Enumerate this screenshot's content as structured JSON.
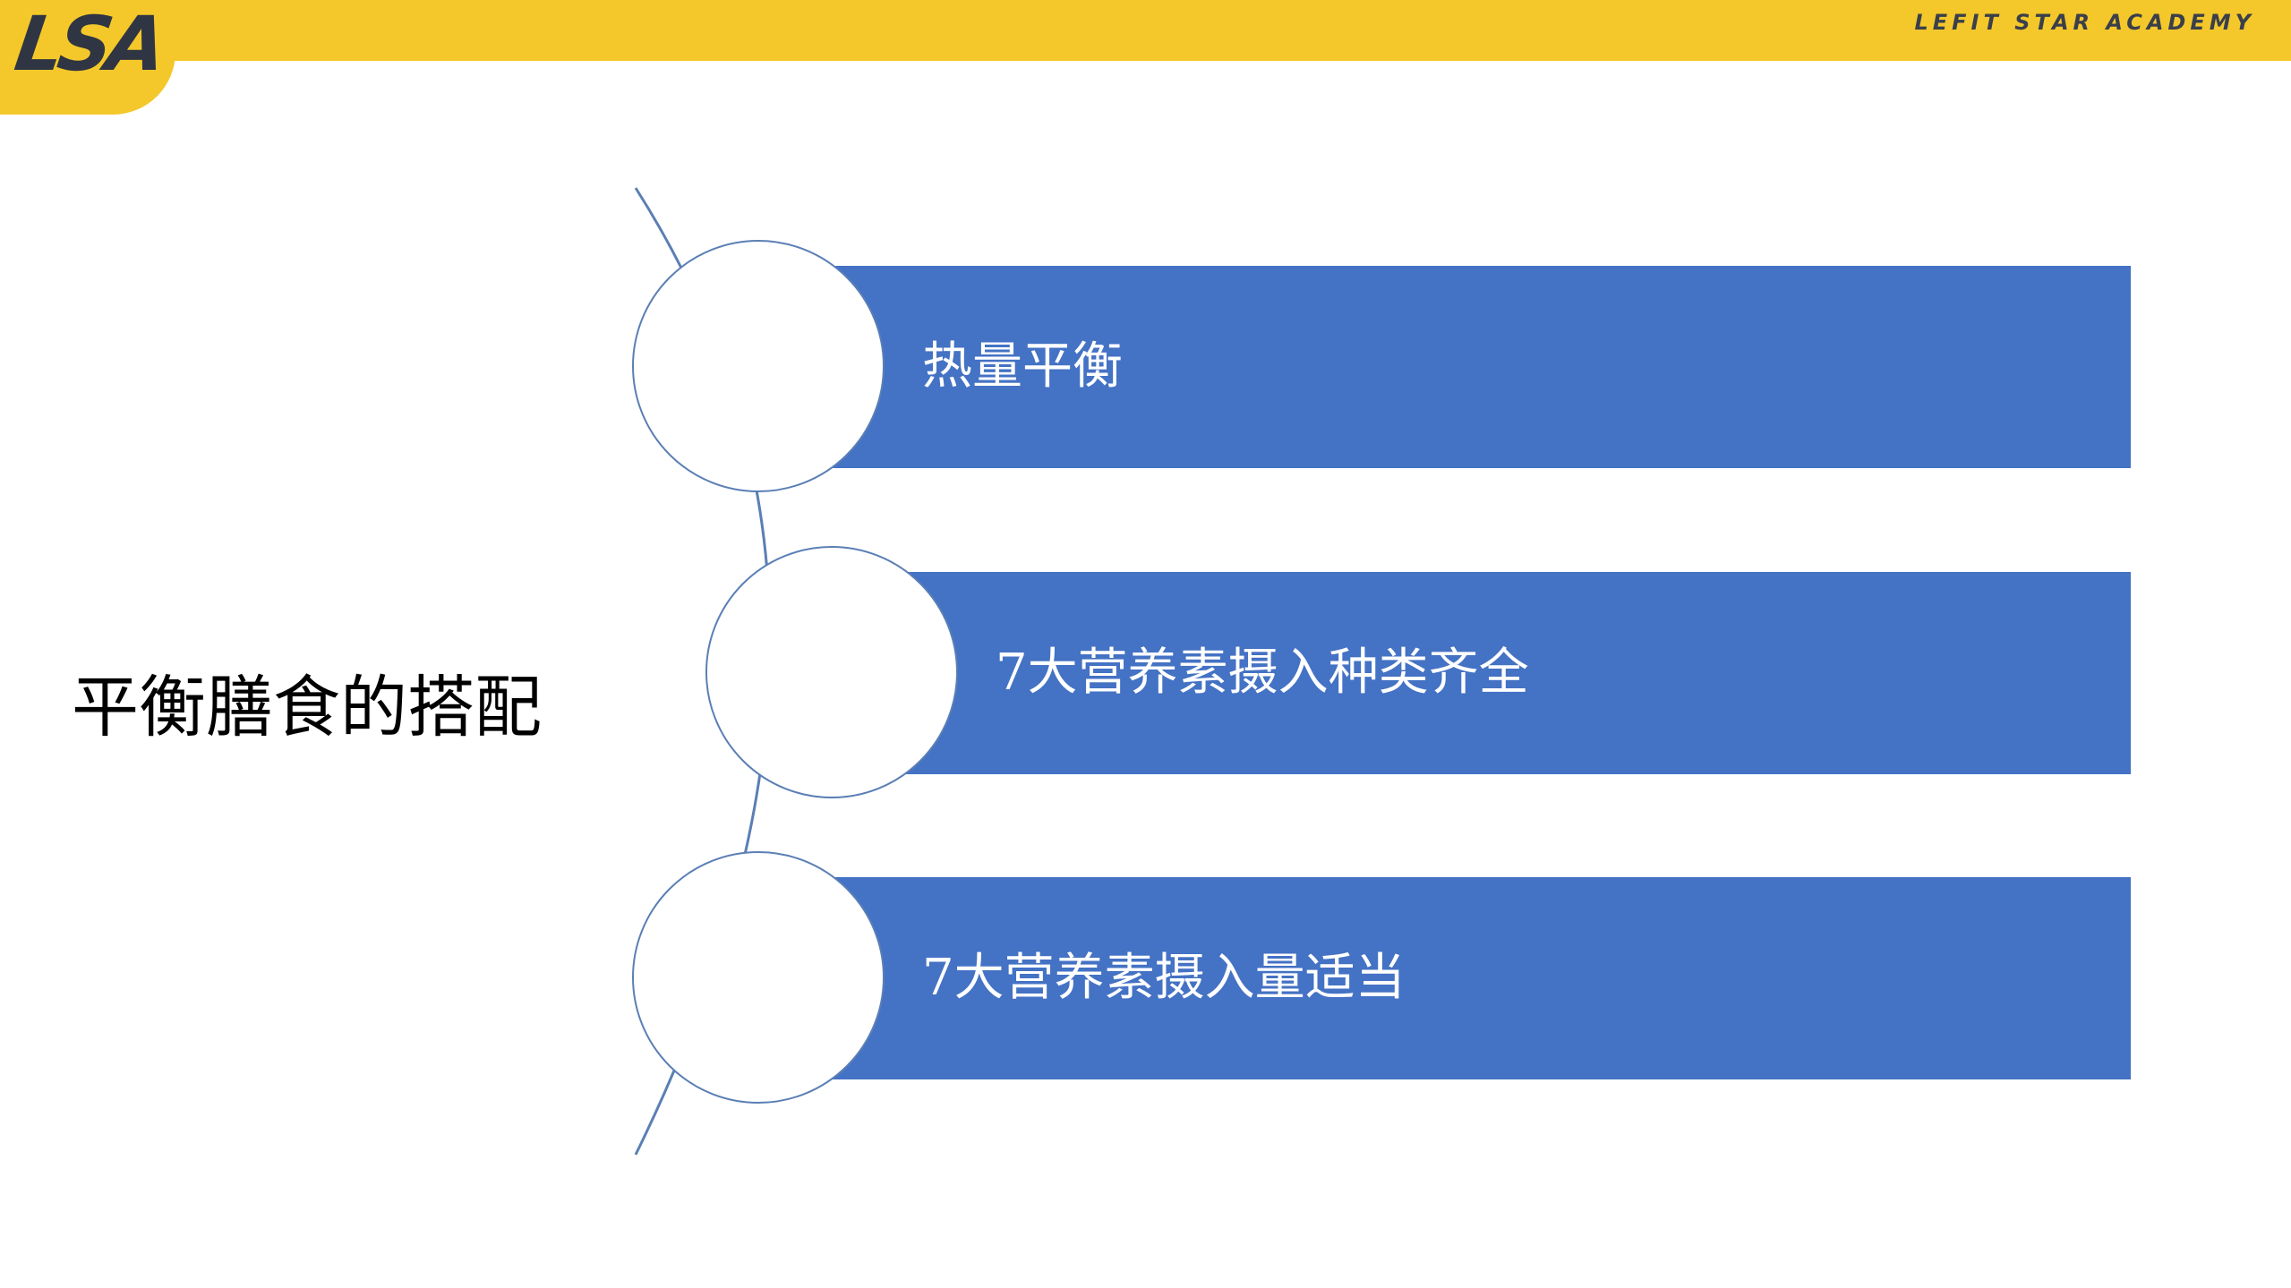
{
  "header": {
    "logo_text": "LSA",
    "brand": "LEFIT STAR ACADEMY"
  },
  "slide": {
    "title": "平衡膳食的搭配",
    "items": [
      {
        "label": "热量平衡"
      },
      {
        "label": "7大营养素摄入种类齐全"
      },
      {
        "label": "7大营养素摄入量适当"
      }
    ]
  },
  "colors": {
    "accent_yellow": "#F4C82A",
    "bar_blue": "#4472C4",
    "circle_border": "#5B7FB5"
  }
}
